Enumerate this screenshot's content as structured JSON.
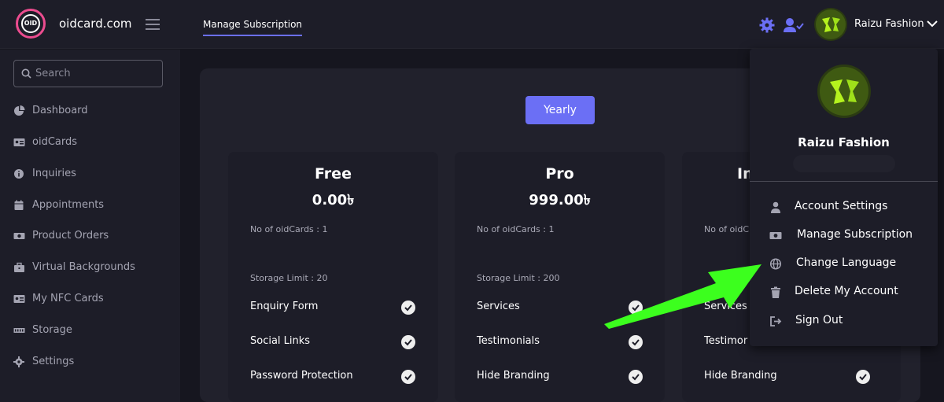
{
  "brand": {
    "logo_text": "OID",
    "site_name": "oidcard.com"
  },
  "header": {
    "active_tab": "Manage Subscription",
    "user_name": "Raizu Fashion"
  },
  "search": {
    "placeholder": "Search"
  },
  "sidebar": {
    "items": [
      {
        "label": "Dashboard",
        "icon": "pie-chart-icon"
      },
      {
        "label": "oidCards",
        "icon": "id-card-icon"
      },
      {
        "label": "Inquiries",
        "icon": "info-icon"
      },
      {
        "label": "Appointments",
        "icon": "calendar-icon"
      },
      {
        "label": "Product Orders",
        "icon": "money-icon"
      },
      {
        "label": "Virtual Backgrounds",
        "icon": "briefcase-icon"
      },
      {
        "label": "My NFC Cards",
        "icon": "card-icon"
      },
      {
        "label": "Storage",
        "icon": "storage-icon"
      },
      {
        "label": "Settings",
        "icon": "gear-icon"
      }
    ]
  },
  "billing_toggle": {
    "label": "Yearly"
  },
  "plans": [
    {
      "name": "Free",
      "price": "0.00৳",
      "oidcards": "No of oidCards : 1",
      "storage": "Storage Limit : 20",
      "features": [
        "Enquiry Form",
        "Social Links",
        "Password Protection"
      ]
    },
    {
      "name": "Pro",
      "price": "999.00৳",
      "oidcards": "No of oidCards : 1",
      "storage": "Storage Limit : 200",
      "features": [
        "Services",
        "Testimonials",
        "Hide Branding"
      ]
    },
    {
      "name": "In",
      "price": "",
      "oidcards": "No of oidC",
      "storage": "",
      "features": [
        "Services",
        "Testimor",
        "Hide Branding"
      ]
    }
  ],
  "dropdown": {
    "name": "Raizu Fashion",
    "items": [
      {
        "label": "Account Settings",
        "icon": "user-icon"
      },
      {
        "label": "Manage Subscription",
        "icon": "money-icon"
      },
      {
        "label": "Change Language",
        "icon": "globe-icon"
      },
      {
        "label": "Delete My Account",
        "icon": "trash-icon"
      },
      {
        "label": "Sign Out",
        "icon": "sign-out-icon"
      }
    ]
  },
  "colors": {
    "accent": "#6b6ff5",
    "brand_pink": "#ec4c8f",
    "arrow_green": "#3cff1e"
  }
}
